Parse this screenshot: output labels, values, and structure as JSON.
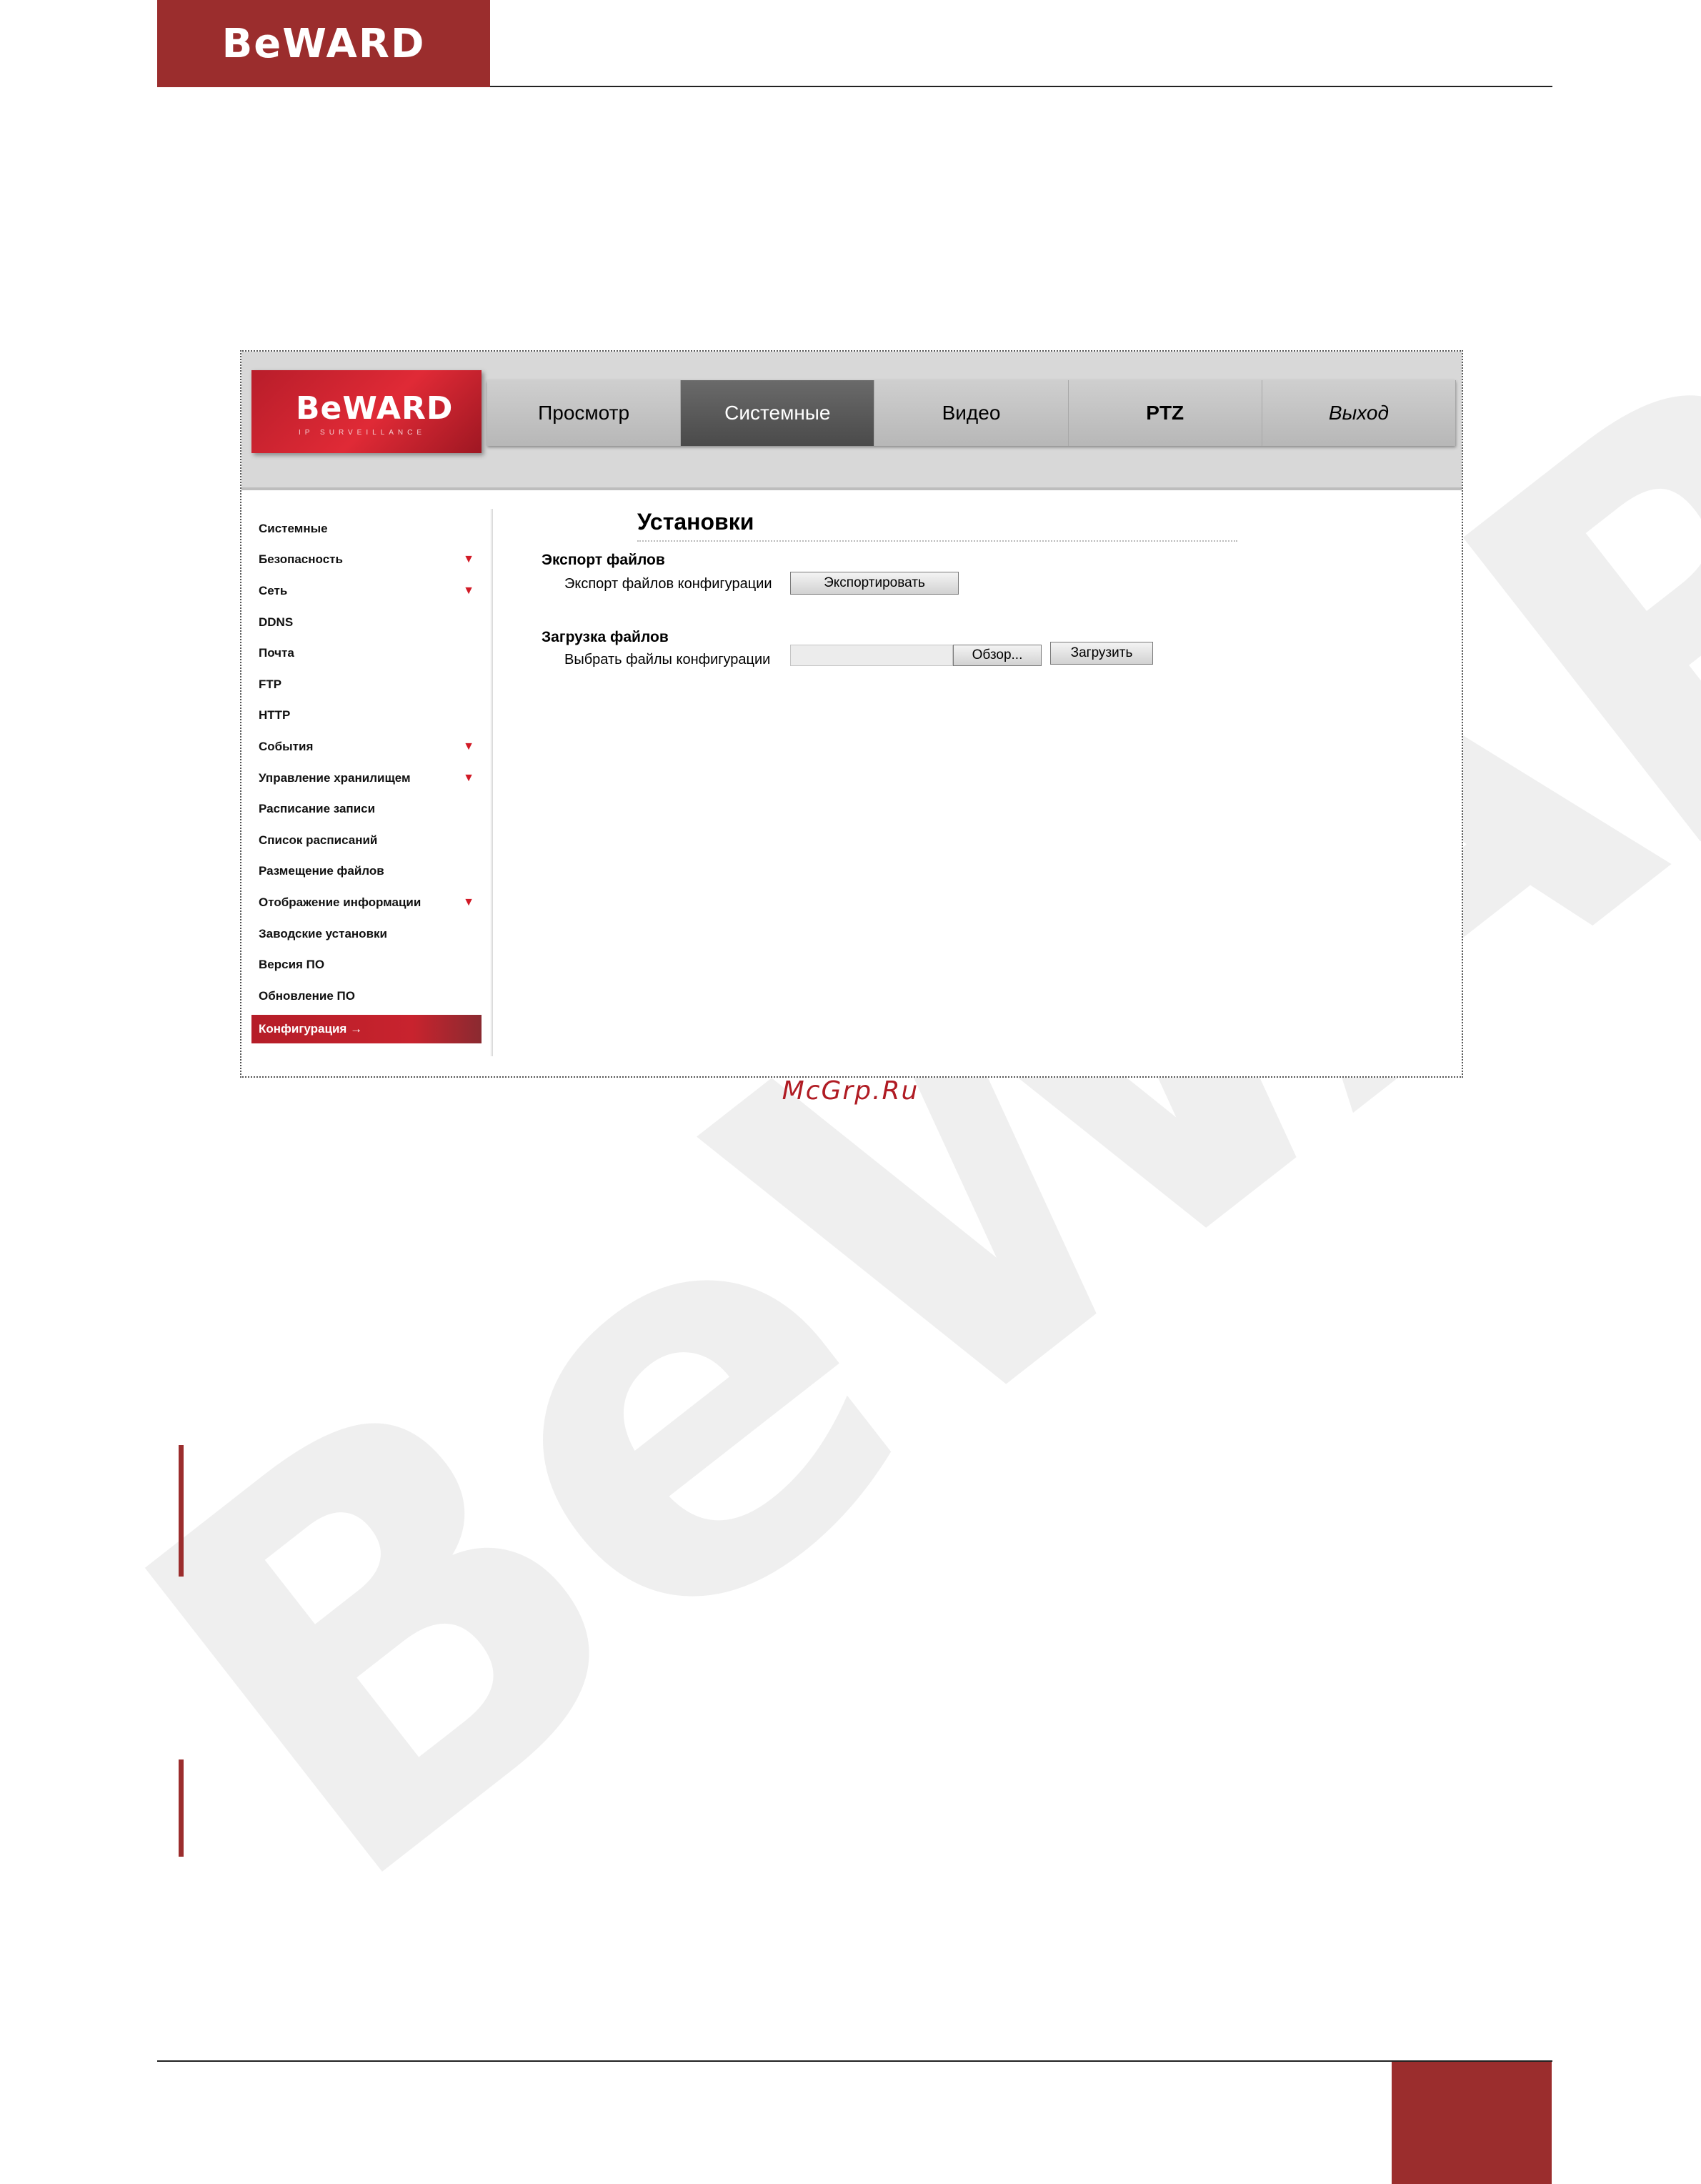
{
  "page": {
    "logo_text": "BeWARD",
    "caption": "McGrp.Ru",
    "watermark": "BeWARD"
  },
  "app": {
    "logo_brand": "BeWARD",
    "logo_tagline": "IP SURVEILLANCE",
    "nav": [
      {
        "label": "Просмотр",
        "active": false
      },
      {
        "label": "Системные",
        "active": true
      },
      {
        "label": "Видео",
        "active": false
      },
      {
        "label": "PTZ",
        "active": false
      },
      {
        "label": "Выход",
        "active": false
      }
    ],
    "sidebar": [
      {
        "label": "Системные",
        "has_submenu": false
      },
      {
        "label": "Безопасность",
        "has_submenu": true
      },
      {
        "label": "Сеть",
        "has_submenu": true
      },
      {
        "label": "DDNS",
        "has_submenu": false
      },
      {
        "label": "Почта",
        "has_submenu": false
      },
      {
        "label": "FTP",
        "has_submenu": false
      },
      {
        "label": "HTTP",
        "has_submenu": false
      },
      {
        "label": "События",
        "has_submenu": true
      },
      {
        "label": "Управление хранилищем",
        "has_submenu": true
      },
      {
        "label": "Расписание записи",
        "has_submenu": false
      },
      {
        "label": "Список расписаний",
        "has_submenu": false
      },
      {
        "label": "Размещение файлов",
        "has_submenu": false
      },
      {
        "label": "Отображение информации",
        "has_submenu": true
      },
      {
        "label": "Заводские установки",
        "has_submenu": false
      },
      {
        "label": "Версия ПО",
        "has_submenu": false
      },
      {
        "label": "Обновление ПО",
        "has_submenu": false
      },
      {
        "label": "Конфигурация",
        "has_submenu": false,
        "active": true
      }
    ],
    "content": {
      "title": "Установки",
      "export": {
        "section_title": "Экспорт файлов",
        "row_label": "Экспорт файлов конфигурации",
        "button_label": "Экспортировать"
      },
      "upload": {
        "section_title": "Загрузка файлов",
        "row_label": "Выбрать файлы конфигурации",
        "browse_label": "Обзор...",
        "button_label": "Загрузить"
      }
    }
  },
  "colors": {
    "brand_red": "#9b2d2d",
    "accent_red": "#c8232e",
    "nav_active": "#555555"
  }
}
